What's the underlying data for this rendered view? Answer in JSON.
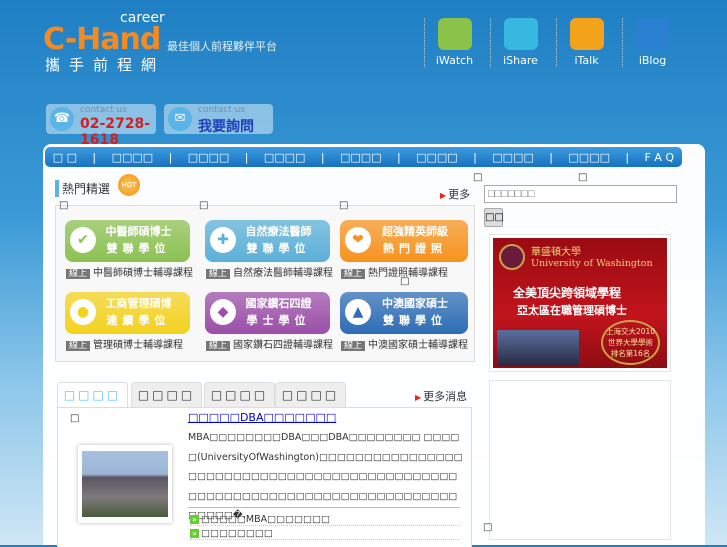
{
  "header": {
    "logo_sup": "career",
    "logo": "C-Hand",
    "logo_cn": "攜手前程網",
    "slogan": "最佳個人前程夥伴平台",
    "icons": [
      {
        "label": "iWatch",
        "icon": "monitor-icon",
        "color": "#8bc34a"
      },
      {
        "label": "iShare",
        "icon": "shopping-bag-icon",
        "color": "#36b8e0"
      },
      {
        "label": "iTalk",
        "icon": "chat-people-icon",
        "color": "#f3a21c"
      },
      {
        "label": "iBlog",
        "icon": "blog-book-icon",
        "color": "#2a7fd0"
      }
    ],
    "contact_phone": {
      "label": "contact us",
      "value": "02-2728-1618"
    },
    "contact_mail": {
      "label": "contact us",
      "value": "我要詢問"
    }
  },
  "nav": [
    "□ □",
    "□□□□",
    "□□□□",
    "□□□□",
    "□□□□",
    "□□□□",
    "□□□□",
    "□□□□",
    "F A Q"
  ],
  "featured": {
    "title": "熱門精選",
    "hot": "HOT",
    "more": "更多",
    "tofu": "□",
    "items": [
      {
        "line1": "中醫師碩博士",
        "line2": "雙聯學位",
        "badge": "線上",
        "caption": "中醫師碩博士輔導課程",
        "color": "#8cc152",
        "icon": "checkmark-icon",
        "glyph": "✔"
      },
      {
        "line1": "自然療法醫師",
        "line2": "雙聯學位",
        "badge": "線上",
        "caption": "自然療法醫師輔導課程",
        "color": "#5bb0d8",
        "icon": "cross-icon",
        "glyph": "✚"
      },
      {
        "line1": "超強精英師級",
        "line2": "熱門證照",
        "badge": "線上",
        "caption": "熱門證照輔導課程",
        "color": "#f7931e",
        "icon": "heart-icon",
        "glyph": "❤"
      },
      {
        "line1": "工商管理碩博",
        "line2": "連續學位",
        "badge": "線上",
        "caption": "管理碩博士輔導課程",
        "color": "#f4d21f",
        "icon": "person-icon",
        "glyph": "●"
      },
      {
        "line1": "國家鑽石四證",
        "line2": "學士學位",
        "badge": "線上",
        "caption": "國家鑽石四證輔導課程",
        "color": "#9b4fa8",
        "icon": "diamond-icon",
        "glyph": "◆"
      },
      {
        "line1": "中澳國家碩士",
        "line2": "雙聯學位",
        "badge": "線上",
        "caption": "中澳國家碩士輔導課程",
        "color": "#2d6db5",
        "icon": "graduation-cap-icon",
        "glyph": "▲"
      }
    ]
  },
  "search": {
    "placeholder": "□□□□□□□",
    "button": "□□"
  },
  "ad": {
    "cn_name": "華盛頓大學",
    "en_name": "University of Washington",
    "line1": "全美頂尖跨領域學程",
    "line2": "亞太區在職管理碩博士",
    "badge1": "上海交大2010",
    "badge2": "世界大學學術",
    "badge3": "排名第16名"
  },
  "news": {
    "tabs": [
      "□□□□",
      "□□□□",
      "□□□□",
      "□□□□"
    ],
    "more": "更多消息",
    "title": "□□□□□DBA□□□□□□□",
    "body": "MBA□□□□□□□□DBA□□□DBA□□□□□□□□ □□□□□(UniversityOfWashington)□□□□□□□□□□□□□□□□□□□□□□□□□□□□□□□□□□□□□□□□□□□□□□□□□□□□□□□□□□□□□□□□□□□□□□□□□□□□□□□□□�.",
    "items": [
      "□□□□□MBA□□□□□□□",
      "□□□□□□□□"
    ]
  }
}
